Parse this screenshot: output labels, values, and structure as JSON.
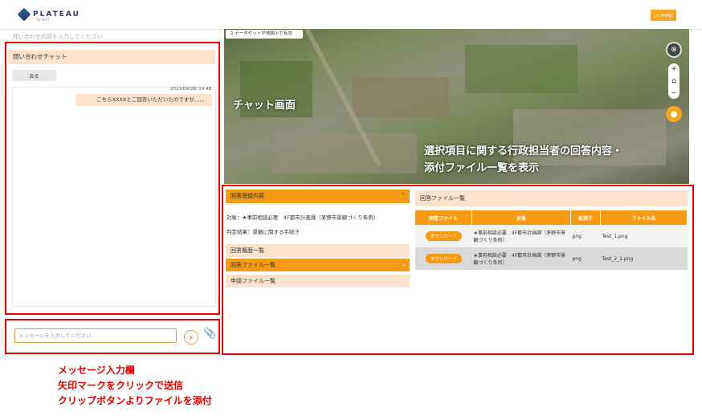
{
  "header": {
    "logo_text": "PLATEAU",
    "logo_sub": "by MLIT",
    "help_label": "Help",
    "help_icon": "clock-icon"
  },
  "left": {
    "faded_text": "問い合わせ内容を入力してください",
    "chat_title": "問い合わせチャット",
    "back_label": "戻る",
    "timestamp": "2023/09/28/ 14:48",
    "message": "こちらXXXXとご回答いただいたのですが、、、、",
    "input_placeholder": "メッセージを入力してください",
    "send_icon": "arrow-right-icon",
    "clip_icon": "paperclip-icon",
    "note": [
      "メッセージ入力欄",
      "矢印マークをクリックで送信",
      "クリップボタンよりファイルを添付"
    ]
  },
  "map": {
    "dataset_chip": "2 データセットが地図上で有効",
    "chat_screen_label": "チャット画面",
    "note": [
      "選択項目に関する行政担当者の回答内容・",
      "添付ファイル一覧を表示"
    ]
  },
  "detail": {
    "reg_header": "回答登録内容",
    "target_line": "対象：★事前相談必要　4F都市計画課（茅野市景観づくり条例）",
    "result_line": "判定結果：景観に関する手続き",
    "nav": [
      "回答履歴一覧",
      "回答ファイル一覧",
      "申請ファイル一覧"
    ],
    "files_title": "回答ファイル一覧",
    "table": {
      "headers": [
        "回答ファイル",
        "対象",
        "拡張子",
        "ファイル名"
      ],
      "rows": [
        {
          "button": "ダウンロード",
          "target": "★事前相談必要　4F都市計画課（茅野市景観づくり条例）",
          "ext": "png",
          "name": "Test_1.png"
        },
        {
          "button": "ダウンロード",
          "target": "★事前相談必要　4F都市計画課（茅野市景観づくり条例）",
          "ext": "png",
          "name": "Test_2_1.png"
        }
      ]
    }
  },
  "colors": {
    "accent": "#f59a14",
    "light_accent": "#fde3cc",
    "annotation": "#e00000"
  }
}
